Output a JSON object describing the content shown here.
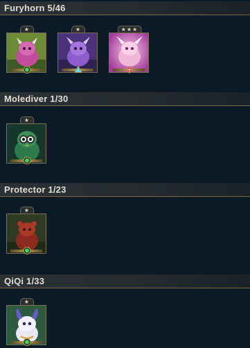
{
  "groups": [
    {
      "title": "Furyhorn 5/46",
      "units": [
        {
          "stars": "★",
          "gem": "green-gem-icon",
          "bg": "#7a8a3a",
          "accent": "#d04aa0"
        },
        {
          "stars": "★",
          "gem": "blue-gem-icon",
          "bg": "#5a3c8c",
          "accent": "#9b6ad8"
        },
        {
          "stars": "★★★",
          "gem": "red-gem-icon",
          "bg": "#b048a8",
          "accent": "#f0b0d8"
        }
      ]
    },
    {
      "title": "Molediver 1/30",
      "units": [
        {
          "stars": "★",
          "gem": "green-gem-icon",
          "bg": "#1e4a3a",
          "accent": "#4aa06a"
        }
      ]
    },
    {
      "title": "Protector 1/23",
      "units": [
        {
          "stars": "★",
          "gem": "green-gem-icon",
          "bg": "#3a3a20",
          "accent": "#9a3a2a"
        }
      ]
    },
    {
      "title": "QiQi 1/33",
      "units": [
        {
          "stars": "★",
          "gem": "green-gem-icon",
          "bg": "#3a6a4a",
          "accent": "#8a8ad8"
        }
      ]
    }
  ]
}
